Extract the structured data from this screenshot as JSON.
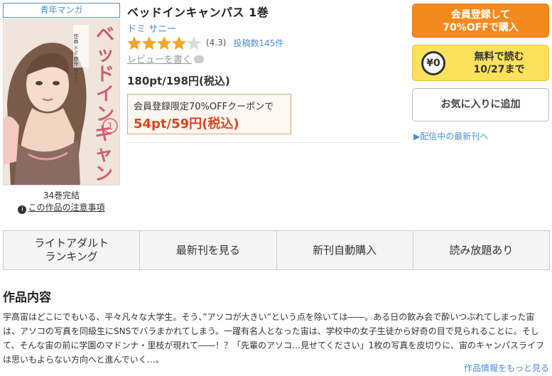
{
  "genre_tag": "青年マンガ",
  "cover": {
    "title_vertical": "ベッドインキャンパス",
    "volume_number": "1",
    "credits": "作画 ドミ 原作 サニー"
  },
  "volumes_total": "34巻完結",
  "notice_link": "この作品の注意事項",
  "notice_icon": "info-icon",
  "title": "ベッドインキャンパス 1巻",
  "author": "ドミ サニー",
  "rating": {
    "stars_filled": 4,
    "stars_total": 5,
    "value": "(4.3)",
    "count": "投稿数145件",
    "star_color": "#f5a623",
    "star_empty_color": "#dddddd"
  },
  "review_link": "レビューを書く",
  "price": "180pt/198円(税込)",
  "coupon": {
    "note": "会員登録限定70%OFFクーポンで",
    "price": "54pt/59円(税込)"
  },
  "buttons": {
    "register": "会員登録して\n70%OFFで購入",
    "free_coin": "¥0",
    "free_read_1": "無料で読む",
    "free_read_2": "10/27まで",
    "favorite": "お気に入りに追加"
  },
  "latest_link": "▶配信中の最新刊へ",
  "tabs": [
    {
      "label": "ライトアダルト\nランキング"
    },
    {
      "label": "最新刊を見る"
    },
    {
      "label": "新刊自動購入"
    },
    {
      "label": "読み放題あり"
    }
  ],
  "section_title": "作品内容",
  "description": "宇髙宙はどこにでもいる、平々凡々な大学生。そう、”アソコが大きい”という点を除いては――。ある日の飲み会で酔いつぶれてしまった宙は、アソコの写真を同級生にSNSでバラまかれてしまう。一躍有名人となった宙は、学校中の女子生徒から好奇の目で見られることに。そして、そんな宙の前に学園のマドンナ・里枝が現れて――！？「先輩のアソコ…見せてください」1枚の写真を皮切りに、宙のキャンパスライフは思いもよらない方向へと進んでいく…。",
  "more_link": "作品情報をもっと見る",
  "colors": {
    "accent_blue": "#4a90d9",
    "register_orange": "#f38a1e",
    "free_yellow": "#fde15a",
    "coupon_red": "#e0451f"
  }
}
